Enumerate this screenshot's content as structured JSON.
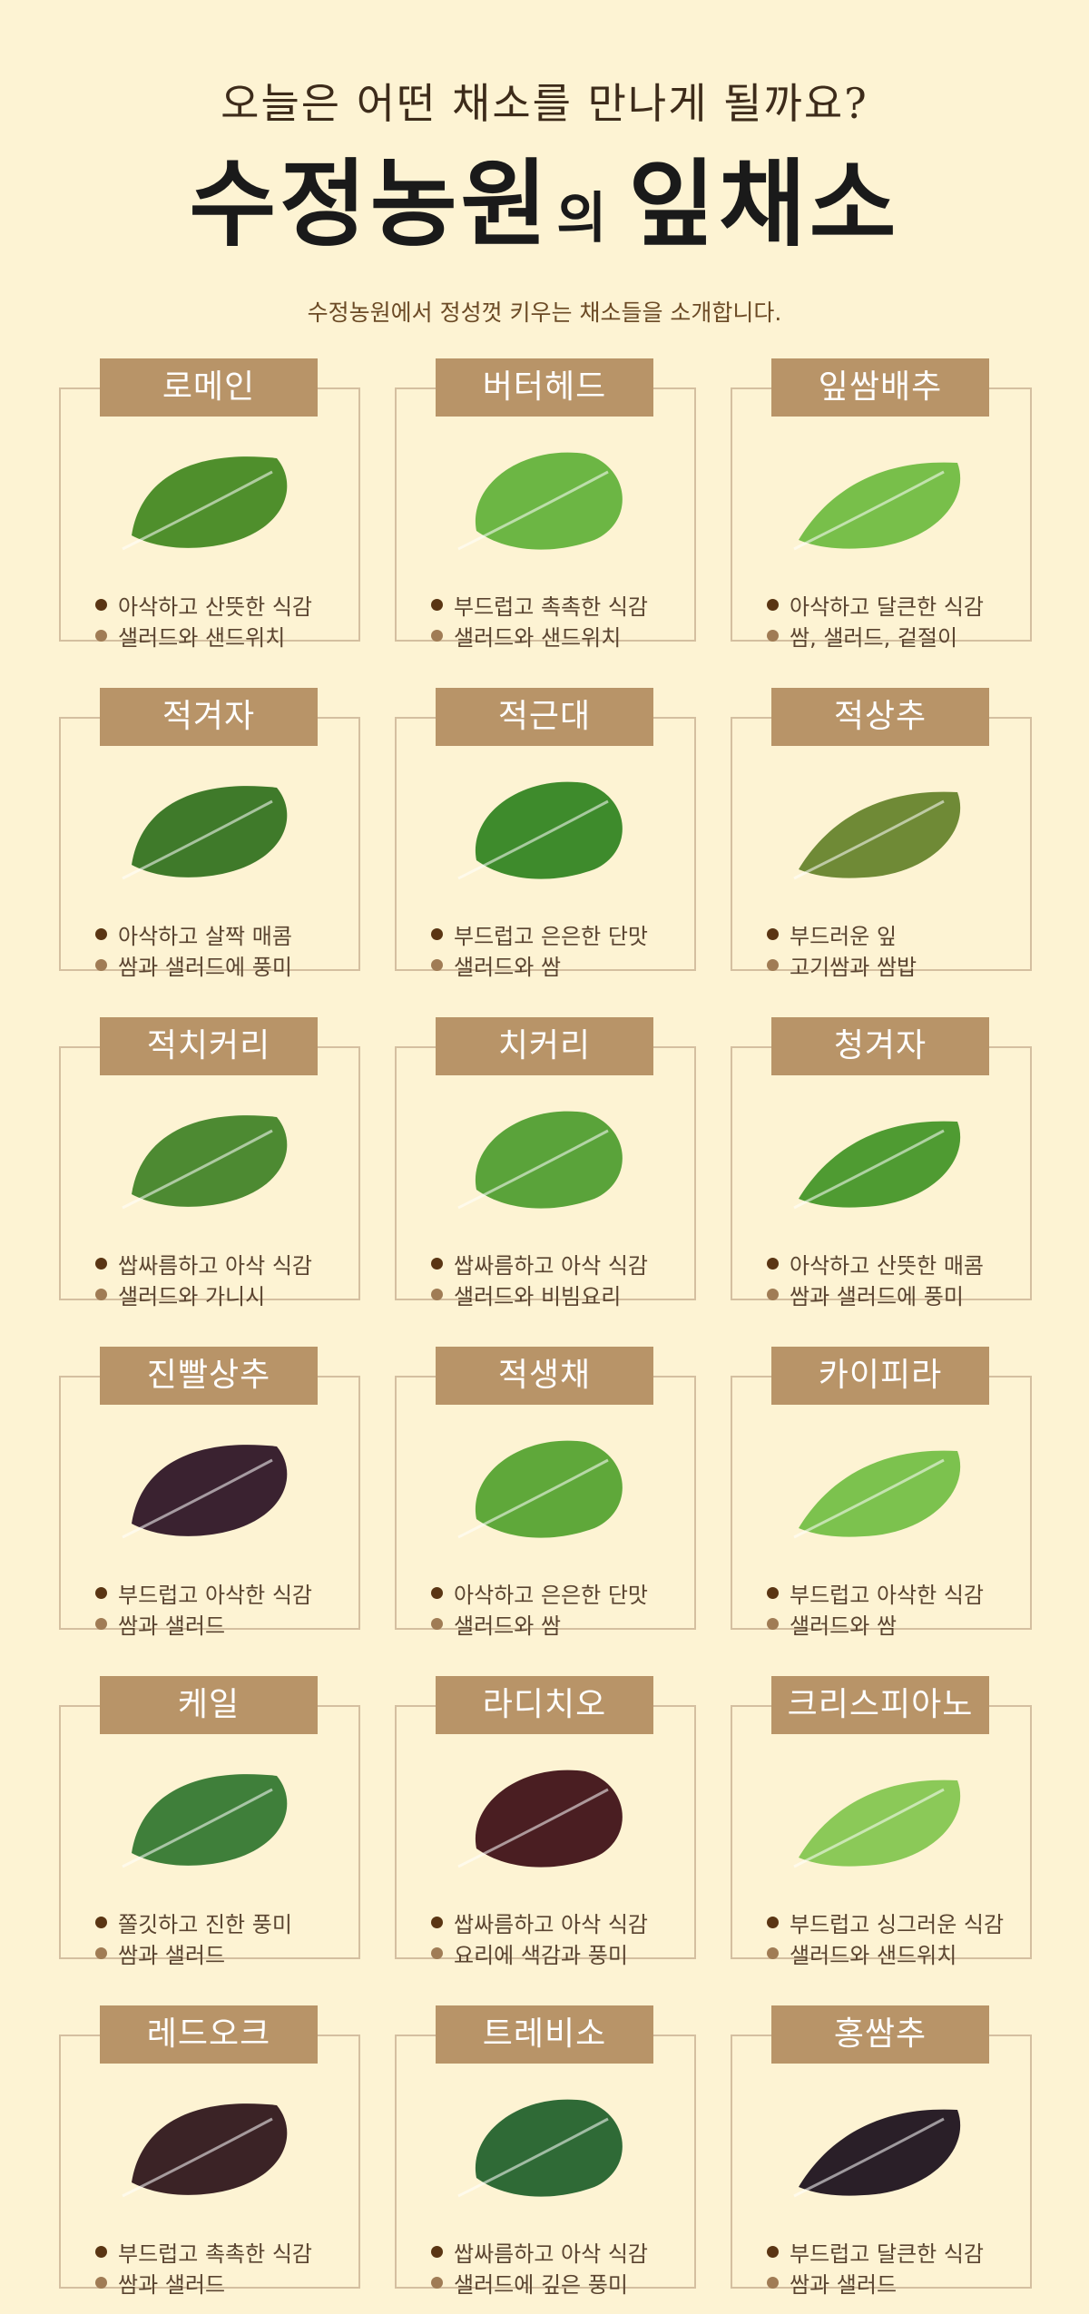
{
  "header": {
    "subtitle": "오늘은 어떤 채소를 만나게 될까요?",
    "title_main": "수정농원",
    "title_particle": "의",
    "title_tail": "잎채소",
    "intro": "수정농원에서 정성껏 키우는 채소들을 소개합니다."
  },
  "colors": {
    "background": "#fdf3d3",
    "label_bg": "#b89468",
    "border": "#d4bfa0",
    "bullet_dark": "#5a3513",
    "bullet_light": "#a07c55"
  },
  "vegetables": [
    {
      "name": "로메인",
      "desc1": "아삭하고 산뜻한 식감",
      "desc2": "샐러드와 샌드위치",
      "icon": "romaine-leaf-icon",
      "color": "#4f8f2c"
    },
    {
      "name": "버터헤드",
      "desc1": "부드럽고 촉촉한 식감",
      "desc2": "샐러드와 샌드위치",
      "icon": "butterhead-leaf-icon",
      "color": "#6cb644"
    },
    {
      "name": "잎쌈배추",
      "desc1": "아삭하고 달큰한 식감",
      "desc2": "쌈, 샐러드, 겉절이",
      "icon": "cabbage-leaf-icon",
      "color": "#78bf4a"
    },
    {
      "name": "적겨자",
      "desc1": "아삭하고 살짝 매콤",
      "desc2": "쌈과 샐러드에 풍미",
      "icon": "red-mustard-leaf-icon",
      "color": "#3f7a2a"
    },
    {
      "name": "적근대",
      "desc1": "부드럽고 은은한 단맛",
      "desc2": "샐러드와 쌈",
      "icon": "red-chard-leaf-icon",
      "color": "#3e8b2c"
    },
    {
      "name": "적상추",
      "desc1": "부드러운 잎",
      "desc2": "고기쌈과 쌈밥",
      "icon": "red-lettuce-leaf-icon",
      "color": "#6f8a36"
    },
    {
      "name": "적치커리",
      "desc1": "쌉싸름하고 아삭 식감",
      "desc2": "샐러드와 가니시",
      "icon": "red-chicory-leaf-icon",
      "color": "#4d8a32"
    },
    {
      "name": "치커리",
      "desc1": "쌉싸름하고 아삭 식감",
      "desc2": "샐러드와 비빔요리",
      "icon": "chicory-leaf-icon",
      "color": "#5aa33a"
    },
    {
      "name": "청겨자",
      "desc1": "아삭하고 산뜻한 매콤",
      "desc2": "쌈과 샐러드에 풍미",
      "icon": "green-mustard-leaf-icon",
      "color": "#4f9b32"
    },
    {
      "name": "진빨상추",
      "desc1": "부드럽고 아삭한 식감",
      "desc2": "쌈과 샐러드",
      "icon": "dark-red-lettuce-leaf-icon",
      "color": "#3a2230"
    },
    {
      "name": "적생채",
      "desc1": "아삭하고 은은한 단맛",
      "desc2": "샐러드와 쌈",
      "icon": "red-greens-leaf-icon",
      "color": "#5fa83a"
    },
    {
      "name": "카이피라",
      "desc1": "부드럽고 아삭한 식감",
      "desc2": "샐러드와 쌈",
      "icon": "caipira-leaf-icon",
      "color": "#7cc24e"
    },
    {
      "name": "케일",
      "desc1": "쫄깃하고 진한 풍미",
      "desc2": "쌈과 샐러드",
      "icon": "kale-leaf-icon",
      "color": "#3f7f3a"
    },
    {
      "name": "라디치오",
      "desc1": "쌉싸름하고 아삭 식감",
      "desc2": "요리에 색감과 풍미",
      "icon": "radicchio-leaf-icon",
      "color": "#4a1e22"
    },
    {
      "name": "크리스피아노",
      "desc1": "부드럽고 싱그러운 식감",
      "desc2": "샐러드와 샌드위치",
      "icon": "crispiano-leaf-icon",
      "color": "#8bc958"
    },
    {
      "name": "레드오크",
      "desc1": "부드럽고 촉촉한 식감",
      "desc2": "쌈과 샐러드",
      "icon": "red-oak-leaf-icon",
      "color": "#3b2326"
    },
    {
      "name": "트레비소",
      "desc1": "쌉싸름하고 아삭 식감",
      "desc2": "샐러드에 깊은 풍미",
      "icon": "treviso-leaf-icon",
      "color": "#2f6a36"
    },
    {
      "name": "홍쌈추",
      "desc1": "부드럽고 달큰한 식감",
      "desc2": "쌈과 샐러드",
      "icon": "red-ssamchu-leaf-icon",
      "color": "#2a1f28"
    }
  ]
}
